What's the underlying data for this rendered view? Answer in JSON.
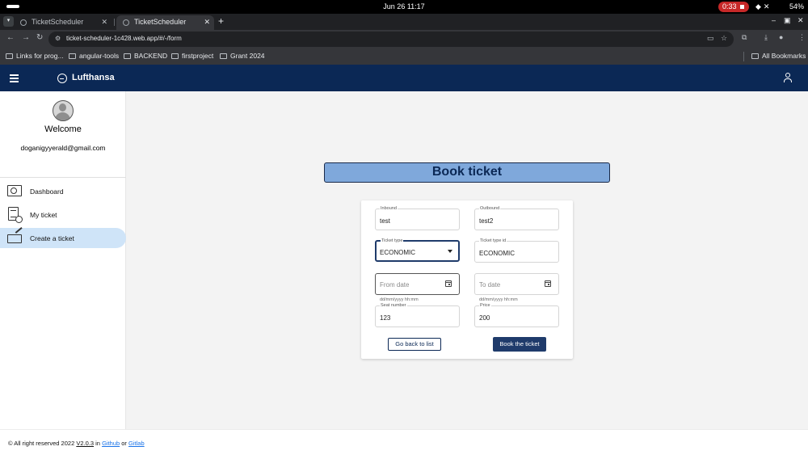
{
  "os": {
    "datetime": "Jun 26  11:17",
    "recording": "0:33",
    "battery": "54%"
  },
  "browser": {
    "tabs": [
      {
        "title": "TicketScheduler"
      },
      {
        "title": "TicketScheduler"
      }
    ],
    "url": "ticket-scheduler-1c428.web.app/#/-/form",
    "bookmarks": [
      "Links for prog...",
      "angular-tools",
      "BACKEND",
      "firstproject",
      "Grant 2024"
    ],
    "all_bookmarks": "All Bookmarks"
  },
  "header": {
    "brand": "Lufthansa"
  },
  "sidebar": {
    "welcome": "Welcome",
    "email": "doganigyyerald@gmail.com",
    "items": [
      {
        "label": "Dashboard",
        "icon": "dashboard-icon"
      },
      {
        "label": "My ticket",
        "icon": "ticket-list-icon"
      },
      {
        "label": "Create a ticket",
        "icon": "create-ticket-icon",
        "active": true
      }
    ]
  },
  "main": {
    "title": "Book ticket",
    "form": {
      "inbound": {
        "label": "Inbound",
        "value": "test"
      },
      "outbound": {
        "label": "Outbound",
        "value": "test2"
      },
      "ticket_type": {
        "label": "Ticket type",
        "value": "ECONOMIC"
      },
      "ticket_type_id": {
        "label": "Ticket type id",
        "value": "ECONOMIC"
      },
      "from_date": {
        "placeholder": "From date",
        "hint": "dd/mm/yyyy hh:mm"
      },
      "to_date": {
        "placeholder": "To date",
        "hint": "dd/mm/yyyy hh:mm"
      },
      "seat_number": {
        "label": "Seat number",
        "value": "123"
      },
      "price": {
        "label": "Price",
        "value": "200"
      }
    },
    "buttons": {
      "back": "Go back to list",
      "book": "Book the ticket"
    }
  },
  "footer": {
    "copyright": "© All right reserved 2022",
    "version": "V2.0.3",
    "in_text": "in",
    "github": "Github",
    "or_text": "or",
    "gitlab": "Gitlab"
  }
}
